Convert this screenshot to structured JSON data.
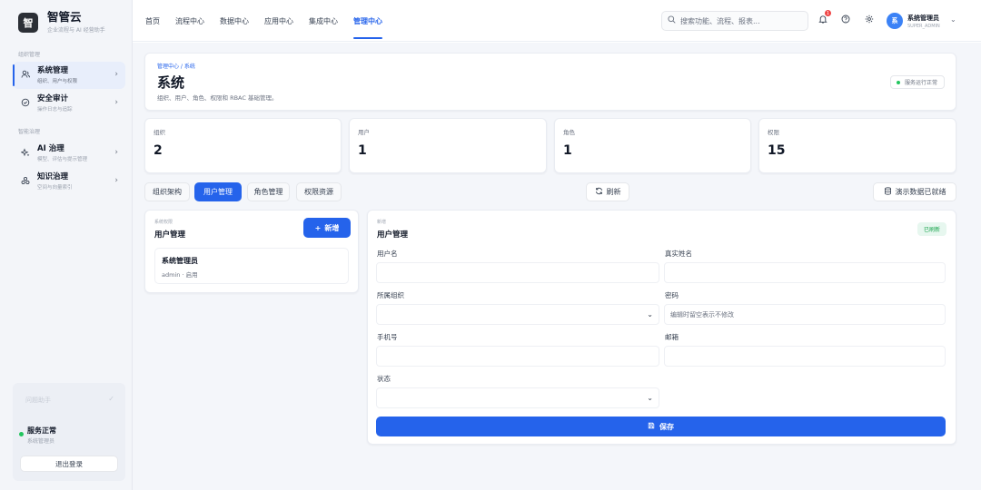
{
  "brand": {
    "name": "智管云",
    "subtitle": "企业流程与 AI 经营助手",
    "logo_text": "智"
  },
  "sidebar": {
    "section_org": "组织管理",
    "section_ai": "智能治理",
    "items": [
      {
        "title": "系统管理",
        "subtitle": "组织、用户与权限",
        "icon": "users-icon"
      },
      {
        "title": "安全审计",
        "subtitle": "操作日志与追踪",
        "icon": "shield-check-icon"
      },
      {
        "title": "AI 治理",
        "subtitle": "模型、评估与提示管理",
        "icon": "sparkle-icon"
      },
      {
        "title": "知识治理",
        "subtitle": "空间与向量索引",
        "icon": "knowledge-icon"
      }
    ],
    "footer": {
      "faded_text": "问题助手",
      "status_title": "服务正常",
      "status_sub": "系统管理员",
      "logout": "退出登录"
    }
  },
  "topnav": {
    "items": [
      "首页",
      "流程中心",
      "数据中心",
      "应用中心",
      "集成中心",
      "管理中心"
    ],
    "active_index": 5,
    "search_placeholder": "搜索功能、流程、报表...",
    "notification_count": "1",
    "user_name": "系统管理员",
    "user_role": "SUPER_ADMIN",
    "avatar_text": "系"
  },
  "header": {
    "breadcrumb": "管理中心 / 系统",
    "title": "系统",
    "description": "组织、用户、角色、权限和 RBAC 基础管理。",
    "service_status": "服务运行正常"
  },
  "stats": [
    {
      "label": "组织",
      "value": "2"
    },
    {
      "label": "用户",
      "value": "1"
    },
    {
      "label": "角色",
      "value": "1"
    },
    {
      "label": "权限",
      "value": "15"
    }
  ],
  "tabs": [
    "组织架构",
    "用户管理",
    "角色管理",
    "权限资源"
  ],
  "active_tab": 1,
  "actions": {
    "refresh": "刷新",
    "demo_ready": "演示数据已就绪"
  },
  "user_list": {
    "small_label": "系统权限",
    "title": "用户管理",
    "add_button": "新增",
    "users": [
      {
        "name": "系统管理员",
        "meta": "admin · 启用"
      }
    ]
  },
  "form": {
    "small_label": "新增",
    "title": "用户管理",
    "refreshed_badge": "已刷新",
    "fields": {
      "username": "用户名",
      "realname": "真实姓名",
      "org": "所属组织",
      "password": "密码",
      "password_placeholder": "编辑时留空表示不修改",
      "phone": "手机号",
      "email": "邮箱",
      "status": "状态"
    },
    "save_button": "保存"
  },
  "colors": {
    "accent": "#2563eb",
    "success": "#22c55e",
    "badge": "#ef4444"
  }
}
